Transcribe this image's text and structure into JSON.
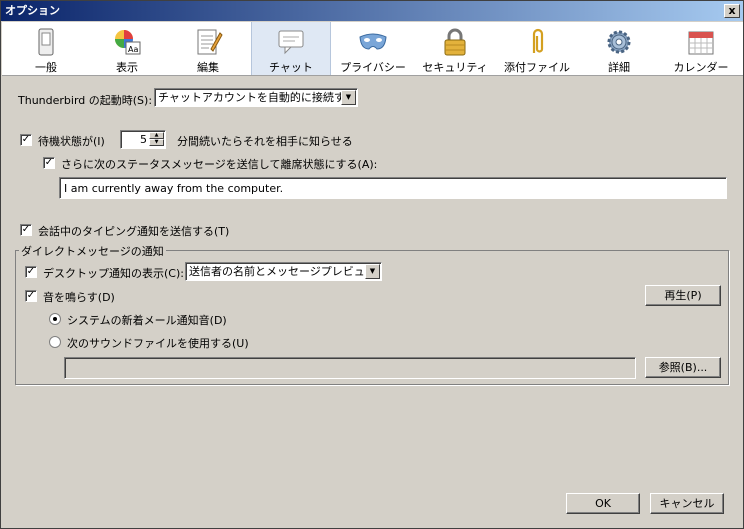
{
  "window": {
    "title": "オプション",
    "close_label": "x"
  },
  "tabs": [
    {
      "label": "一般",
      "icon": "switch-icon"
    },
    {
      "label": "表示",
      "icon": "colors-fonts-icon"
    },
    {
      "label": "編集",
      "icon": "notepad-icon"
    },
    {
      "label": "チャット",
      "icon": "speech-bubble-icon"
    },
    {
      "label": "プライバシー",
      "icon": "mask-icon"
    },
    {
      "label": "セキュリティ",
      "icon": "padlock-icon"
    },
    {
      "label": "添付ファイル",
      "icon": "paperclip-icon"
    },
    {
      "label": "詳細",
      "icon": "gear-icon"
    },
    {
      "label": "カレンダー",
      "icon": "calendar-icon"
    }
  ],
  "chat": {
    "startup_label": "Thunderbird の起動時(S):",
    "startup_value": "チャットアカウントを自動的に接続する",
    "idle_checked": true,
    "idle_label": "待機状態が(I)",
    "idle_minutes": "5",
    "idle_suffix": "分間続いたらそれを相手に知らせる",
    "away_checked": true,
    "away_label": "さらに次のステータスメッセージを送信して離席状態にする(A):",
    "away_message": "I am currently away from the computer.",
    "typing_checked": true,
    "typing_label": "会話中のタイピング通知を送信する(T)",
    "dm_group_title": "ダイレクトメッセージの通知",
    "desktop_checked": true,
    "desktop_label": "デスクトップ通知の表示(C):",
    "desktop_value": "送信者の名前とメッセージプレビュー",
    "sound_checked": true,
    "sound_label": "音を鳴らす(D)",
    "play_button": "再生(P)",
    "system_sound_label": "システムの新着メール通知音(D)",
    "custom_sound_label": "次のサウンドファイルを使用する(U)",
    "custom_sound_path": "",
    "browse_button": "参照(B)..."
  },
  "footer": {
    "ok_button": "OK",
    "cancel_button": "キャンセル"
  }
}
